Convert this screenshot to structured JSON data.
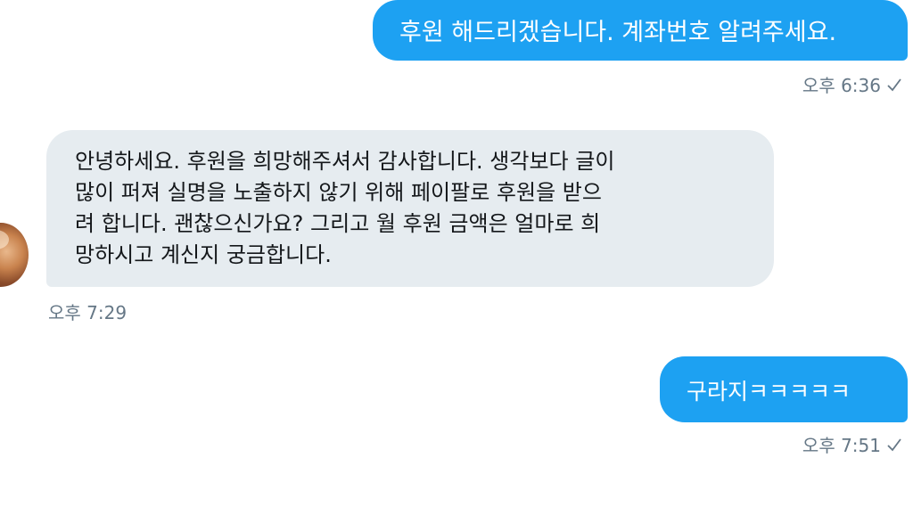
{
  "messages": [
    {
      "direction": "outgoing",
      "text": "후원 해드리겠습니다. 계좌번호 알려주세요.",
      "time": "오후 6:36",
      "read_icon": "checkmark-icon"
    },
    {
      "direction": "incoming",
      "lines": [
        "안녕하세요. 후원을 희망해주셔서 감사합니다. 생각보다 글이",
        "많이 퍼져 실명을 노출하지 않기 위해 페이팔로 후원을 받으",
        "려 합니다. 괜찮으신가요? 그리고 월 후원 금액은 얼마로 희",
        "망하시고 계신지 궁금합니다."
      ],
      "time": "오후 7:29",
      "avatar": "avatar-image"
    },
    {
      "direction": "outgoing",
      "text": "구라지ㅋㅋㅋㅋㅋ",
      "time": "오후 7:51",
      "read_icon": "checkmark-icon"
    }
  ],
  "colors": {
    "outgoing_bubble": "#1da1f2",
    "incoming_bubble": "#e6ecf0",
    "meta_text": "#657786"
  }
}
